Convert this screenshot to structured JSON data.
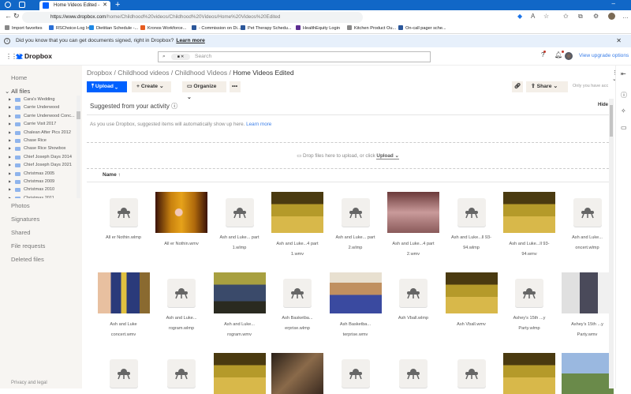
{
  "browser": {
    "tab_title": "Home Videos Edited - Dropbox",
    "url_domain": "https://www.dropbox.com",
    "url_path": "/home/Childhood%20videos/Childhood%20Videos/Home%20Videos%20Edited",
    "bookmarks": [
      {
        "label": "Import favorites",
        "color": "#888"
      },
      {
        "label": "RSChoice-Log In",
        "color": "#2a6fd6"
      },
      {
        "label": "Dietitian Schedule -...",
        "color": "#1e88e5"
      },
      {
        "label": "Kronos Workforce...",
        "color": "#e65c1f"
      },
      {
        "label": "- Commission on Di...",
        "color": "#2b579a"
      },
      {
        "label": "Pet Therapy Schedu...",
        "color": "#2b579a"
      },
      {
        "label": "HealthEquity Login",
        "color": "#5c2d91"
      },
      {
        "label": "Kitchen Product Ou...",
        "color": "#888"
      },
      {
        "label": "On-call pager sche...",
        "color": "#2b579a"
      }
    ]
  },
  "banner": {
    "text": "Did you know that you can get documents signed, right in Dropbox?",
    "link": "Learn more"
  },
  "header": {
    "logo": "Dropbox",
    "search_placeholder": "Search",
    "upgrade": "View upgrade options"
  },
  "sidebar": {
    "home": "Home",
    "all_files": "All files",
    "tree": [
      "Cara's Wedding",
      "Carrie Underwood",
      "Carrie Underwood Conc...",
      "Carrie Visit 2017",
      "Chalean After Pics 2012",
      "Chase Rice",
      "Chase Rice Showbox",
      "Chief Joseph Days 2014",
      "Chief Joseph Days 2021",
      "Christmas 2005",
      "Christmas 2009",
      "Christmas 2010",
      "Christmas 2011"
    ],
    "items": [
      "Photos",
      "Signatures",
      "Shared",
      "File requests",
      "Deleted files"
    ],
    "footer": "Privacy and legal"
  },
  "main": {
    "breadcrumb": [
      "Dropbox",
      "Childhood videos",
      "Childhood Videos",
      "Home Videos Edited"
    ],
    "sep": "/",
    "upload": "Upload",
    "create": "Create",
    "organize": "Organize",
    "share": "Share",
    "access_note": "Only you have acc",
    "suggested_title": "Suggested from your activity",
    "hide": "Hide",
    "suggested_text": "As you use Dropbox, suggested items will automatically show up here.",
    "learn_more": "Learn more",
    "drop_text": "Drop files here to upload, or click",
    "drop_upload": "Upload",
    "sort_label": "Name",
    "files": [
      {
        "name": "All er Nothin.wlmp",
        "thumb": "none"
      },
      {
        "name": "All er Nothin.wmv",
        "thumb": "stage"
      },
      {
        "name": "Ash and Luke... part 1.wlmp",
        "thumb": "none"
      },
      {
        "name": "Ash and Luke...4 part 1.wmv",
        "thumb": "gym"
      },
      {
        "name": "Ash and Luke... part 2.wlmp",
        "thumb": "none"
      },
      {
        "name": "Ash and Luke...4 part 2.wmv",
        "thumb": "room"
      },
      {
        "name": "Ash and Luke...ll 93-94.wlmp",
        "thumb": "none"
      },
      {
        "name": "Ash and Luke...ll 93-94.wmv",
        "thumb": "gym"
      },
      {
        "name": "Ash and Luke... oncert.wlmp",
        "thumb": "none"
      },
      {
        "name": "Ash and Luke concert.wmv",
        "thumb": "choir"
      },
      {
        "name": "Ash and Luke... rogram.wlmp",
        "thumb": "none"
      },
      {
        "name": "Ash and Luke... rogram.wmv",
        "thumb": "group"
      },
      {
        "name": "Ash Basketba... erprise.wlmp",
        "thumb": "none"
      },
      {
        "name": "Ash Basketba... terprise.wmv",
        "thumb": "team"
      },
      {
        "name": "Ash Vball.wlmp",
        "thumb": "none"
      },
      {
        "name": "Ash Vball.wmv",
        "thumb": "gym"
      },
      {
        "name": "Ashey's 15th ...y Party.wlmp",
        "thumb": "none"
      },
      {
        "name": "Ashey's 15th ...y Party.wmv",
        "thumb": "party"
      },
      {
        "name": "",
        "thumb": "none"
      },
      {
        "name": "",
        "thumb": "none"
      },
      {
        "name": "",
        "thumb": "gym"
      },
      {
        "name": "",
        "thumb": "blur"
      },
      {
        "name": "",
        "thumb": "none"
      },
      {
        "name": "",
        "thumb": "none"
      },
      {
        "name": "",
        "thumb": "none"
      },
      {
        "name": "",
        "thumb": "gym"
      },
      {
        "name": "",
        "thumb": "sky"
      }
    ]
  },
  "colors": {
    "accent": "#0061fe",
    "link": "#3a7ee8",
    "sidebar_bg": "#f7f5f2",
    "browser_tab_bar": "#1167c7"
  }
}
